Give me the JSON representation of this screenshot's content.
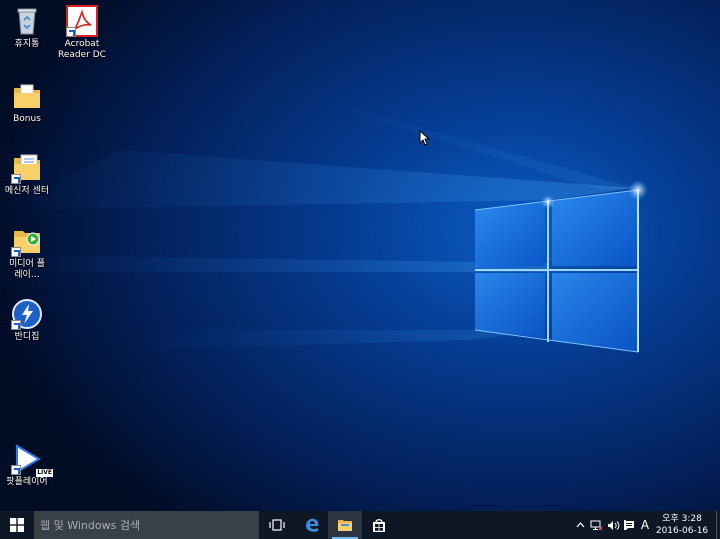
{
  "desktop": {
    "icons": [
      {
        "label": "휴지통"
      },
      {
        "label": "Acrobat Reader DC"
      },
      {
        "label": "Bonus"
      },
      {
        "label": "메신저 센터"
      },
      {
        "label": "미디어 플레이…"
      },
      {
        "label": "반디집"
      },
      {
        "label": "팟플레이어"
      }
    ],
    "live_badge": "LIVE"
  },
  "taskbar": {
    "search_placeholder": "웹 및 Windows 검색",
    "ime_indicator": "A",
    "clock_time": "오후 3:28",
    "clock_date": "2016-06-16",
    "pinned": [
      "task-view-icon",
      "edge-icon",
      "file-explorer-icon",
      "store-icon"
    ]
  },
  "colors": {
    "taskbar": "#0e1725",
    "search_box": "#3a4049",
    "accent": "#76b9ed",
    "wallpaper_glow": "#3fa3ff"
  }
}
